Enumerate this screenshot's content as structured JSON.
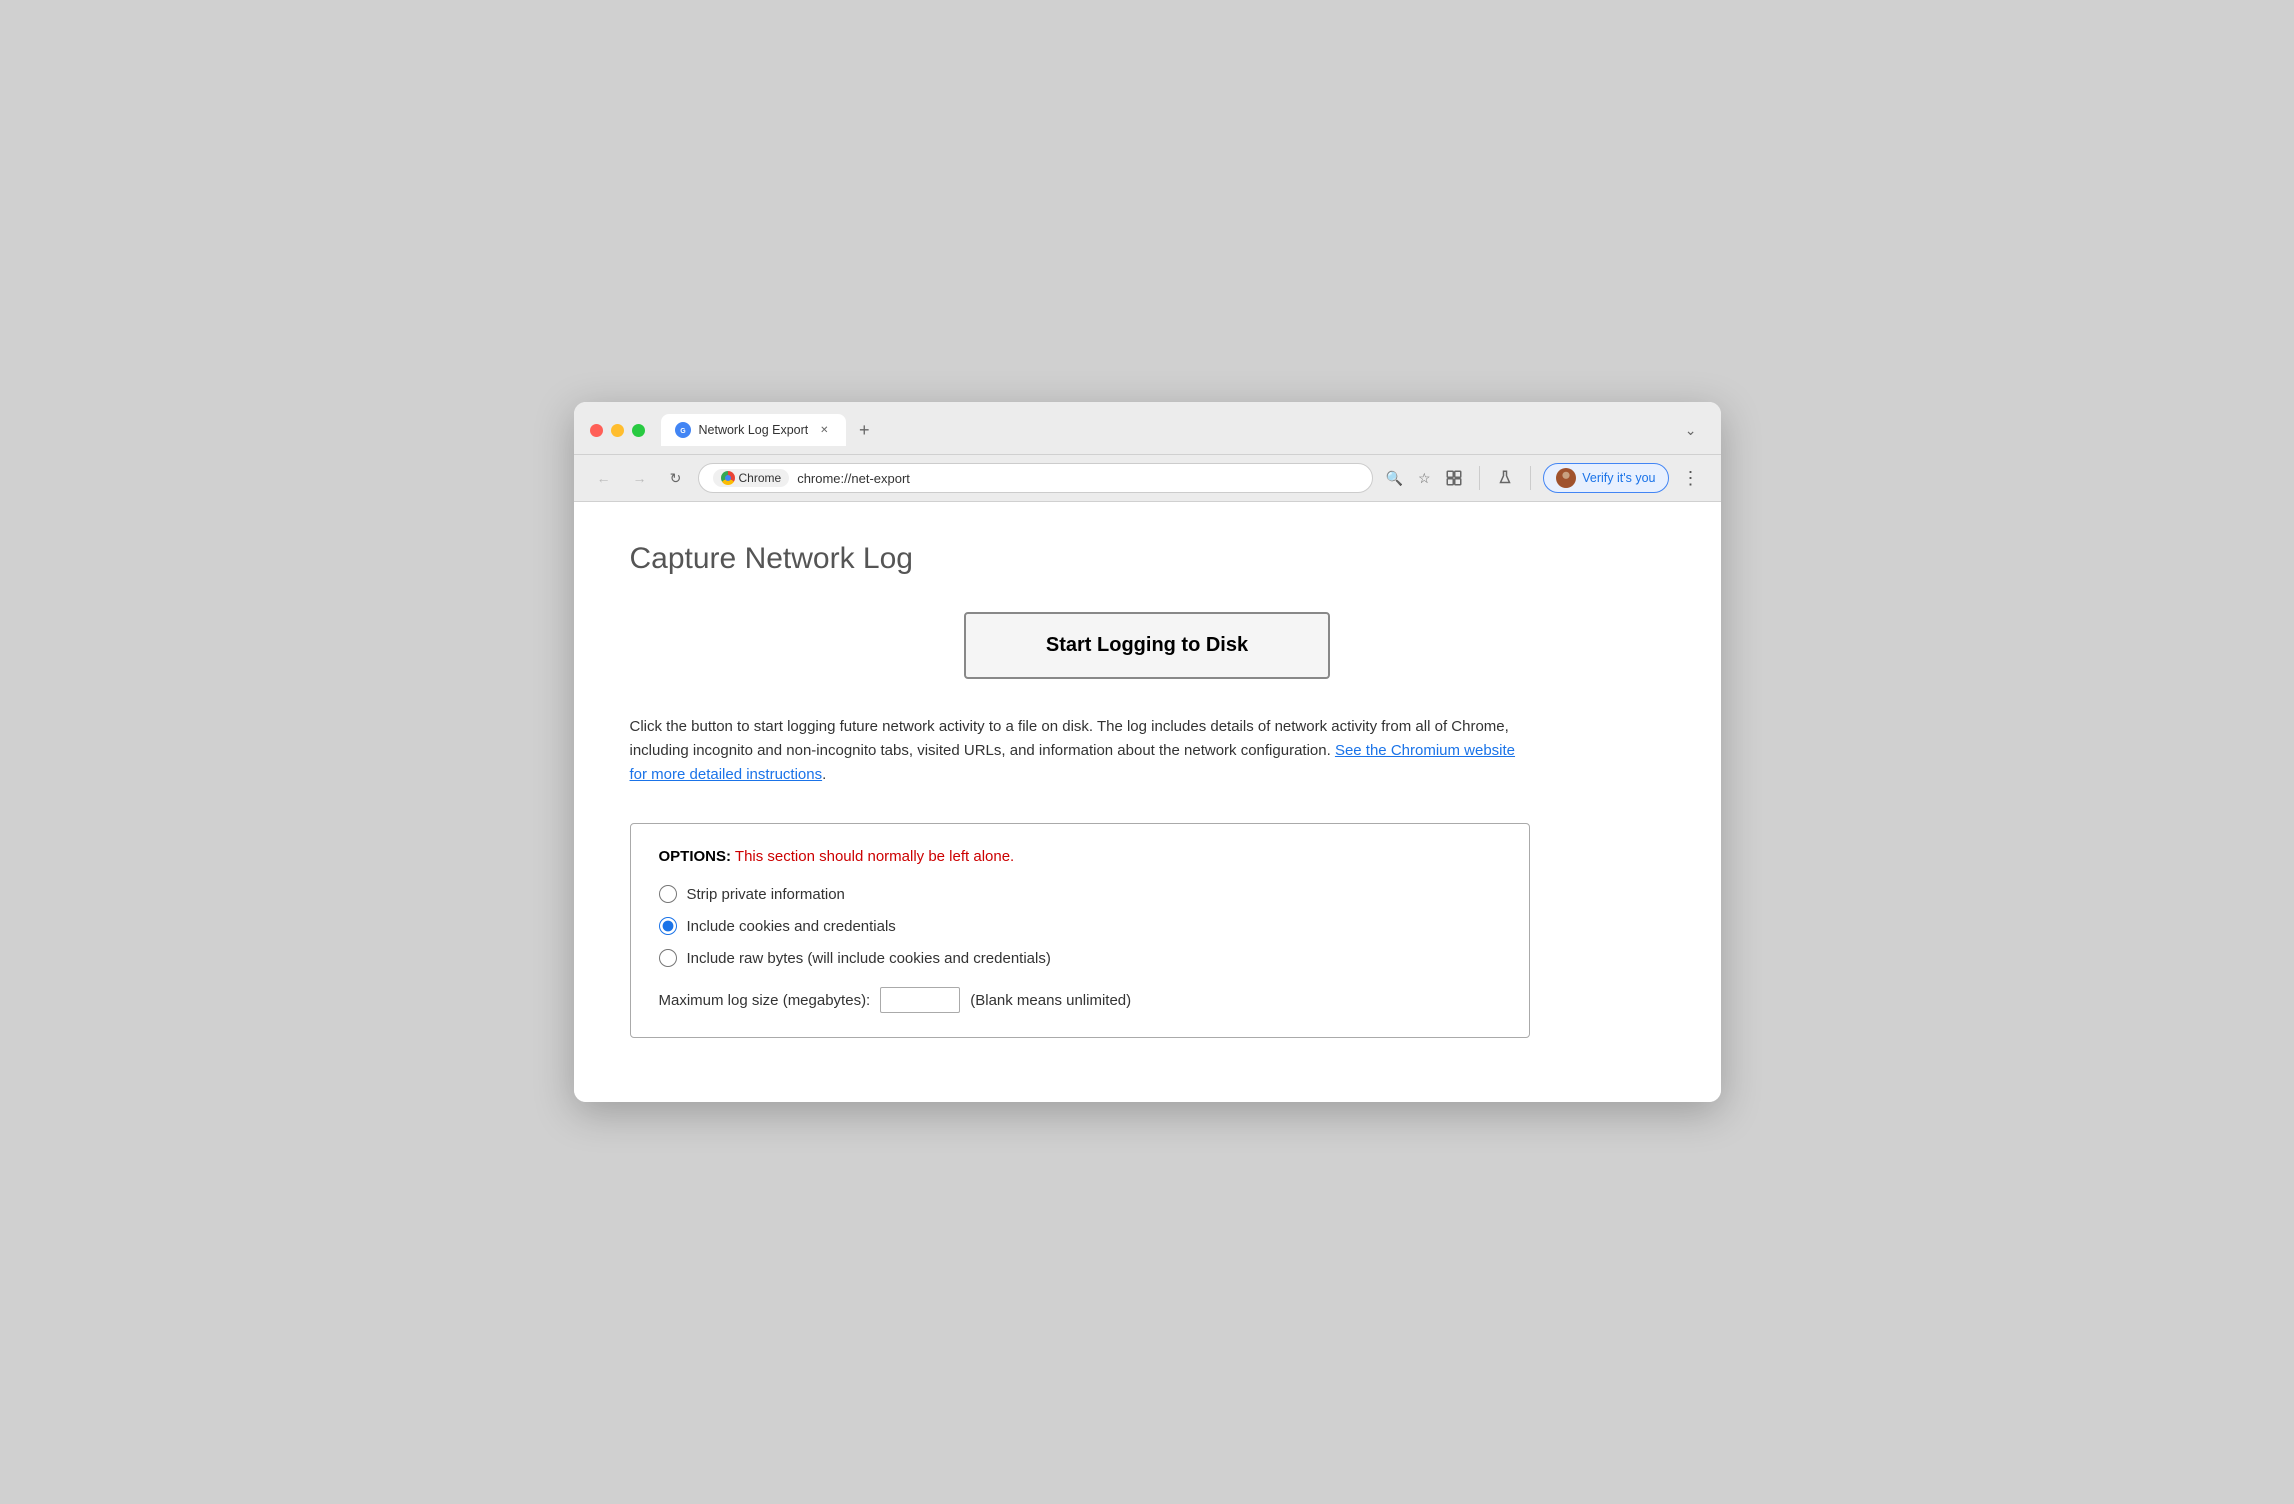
{
  "browser": {
    "tab": {
      "title": "Network Log Export",
      "url": "chrome://net-export"
    },
    "chrome_label": "Chrome",
    "address": "chrome://net-export",
    "new_tab_label": "+",
    "chevron_label": "⌄",
    "profile_label": "Verify it's you",
    "menu_label": "⋮"
  },
  "page": {
    "title": "Capture Network Log",
    "start_button_label": "Start Logging to Disk",
    "description_before_link": "Click the button to start logging future network activity to a file on disk. The log includes details of network activity from all of Chrome, including incognito and non-incognito tabs, visited URLs, and information about the network configuration. ",
    "description_link_text": "See the Chromium website for more detailed instructions",
    "description_after_link": ".",
    "options": {
      "header_bold": "OPTIONS:",
      "header_warning": " This section should normally be left alone.",
      "radio_items": [
        {
          "id": "strip",
          "label": "Strip private information",
          "checked": false
        },
        {
          "id": "cookies",
          "label": "Include cookies and credentials",
          "checked": true
        },
        {
          "id": "rawbytes",
          "label": "Include raw bytes (will include cookies and credentials)",
          "checked": false
        }
      ],
      "max_log_label_before": "Maximum log size (megabytes):",
      "max_log_label_after": "(Blank means unlimited)",
      "max_log_value": ""
    }
  }
}
